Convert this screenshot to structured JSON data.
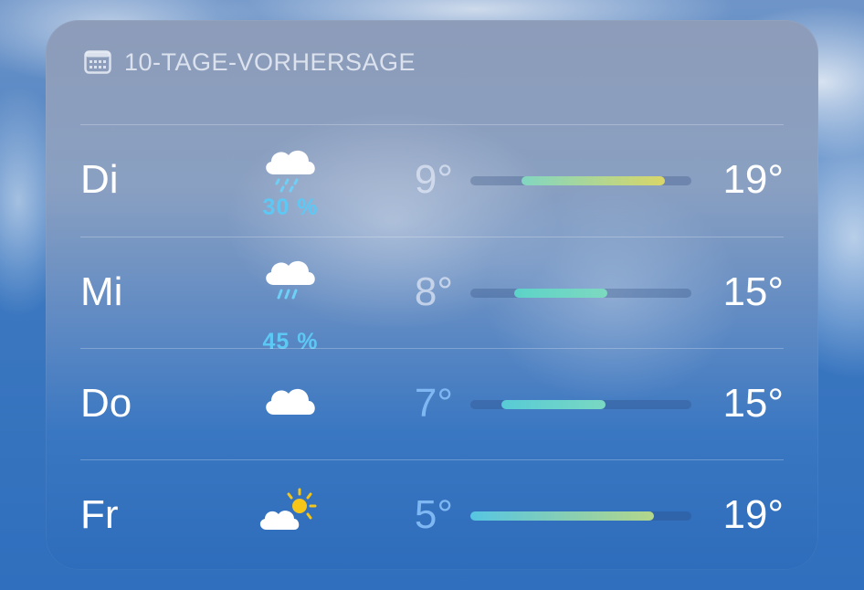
{
  "widget": {
    "title": "10-TAGE-VORHERSAGE",
    "header_icon": "calendar-icon"
  },
  "days": [
    {
      "day": "Di",
      "icon": "cloud-drizzle-icon",
      "precip": "30 %",
      "low": "9°",
      "high": "19°",
      "bar_start": 0.23,
      "bar_end": 0.88,
      "gradient": [
        "#82d6c2",
        "#d9d668"
      ]
    },
    {
      "day": "Mi",
      "icon": "cloud-rain-icon",
      "precip": "45 %",
      "low": "8°",
      "high": "15°",
      "bar_start": 0.2,
      "bar_end": 0.62,
      "gradient": [
        "#5dd2c8",
        "#7dd9c0"
      ]
    },
    {
      "day": "Do",
      "icon": "cloud-icon",
      "precip": "",
      "low": "7°",
      "high": "15°",
      "bar_start": 0.14,
      "bar_end": 0.61,
      "gradient": [
        "#58cbd6",
        "#79d8c2"
      ]
    },
    {
      "day": "Fr",
      "icon": "cloud-sun-icon",
      "precip": "",
      "low": "5°",
      "high": "19°",
      "bar_start": 0.0,
      "bar_end": 0.83,
      "gradient": [
        "#56c6e2",
        "#b3d68a"
      ]
    }
  ],
  "colors": {
    "precip_text": "#5ec8f5",
    "sun": "#f5c518",
    "bar_track": "#3a5a8c"
  }
}
